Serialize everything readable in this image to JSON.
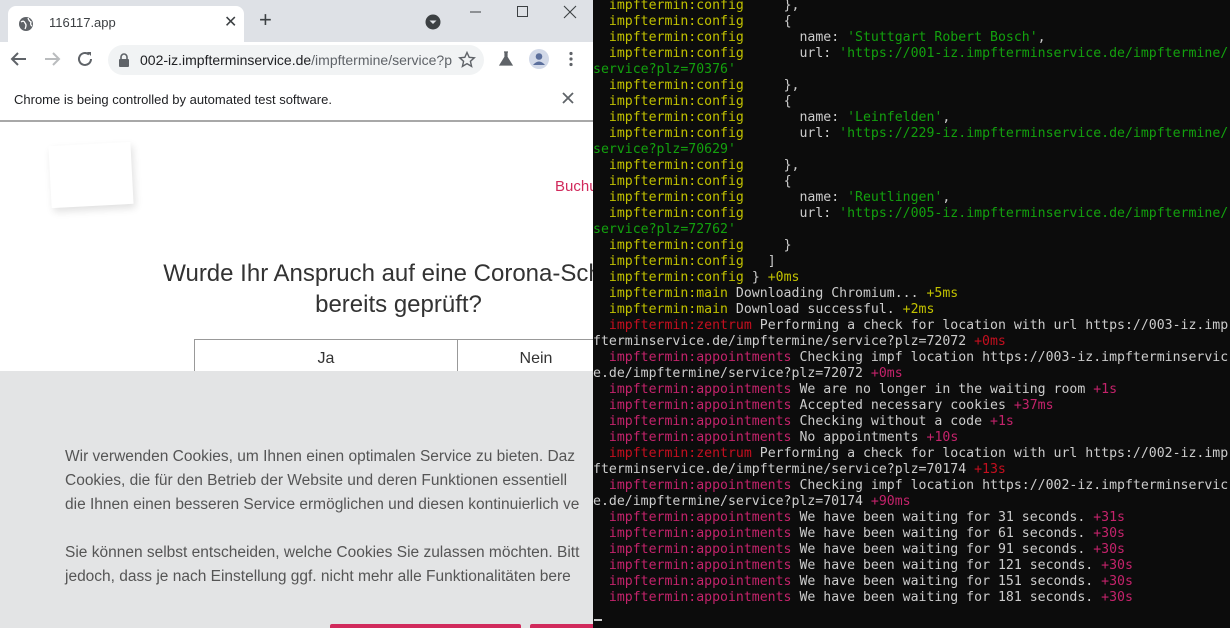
{
  "browser": {
    "tab_title": "116117.app",
    "url_host": "002-iz.impfterminservice.de",
    "url_path": "/impftermine/service?p",
    "infobar_message": "Chrome is being controlled by automated test software.",
    "icons": [
      "globe-icon",
      "close-icon",
      "plus-icon",
      "tab-search-icon",
      "minimize-icon",
      "maximize-icon",
      "window-close-icon",
      "back-arrow-icon",
      "forward-arrow-icon",
      "reload-icon",
      "lock-icon",
      "star-icon",
      "flask-icon",
      "profile-icon",
      "kebab-menu-icon"
    ]
  },
  "page": {
    "nav_link": "Buchu",
    "question_line1": "Wurde Ihr Anspruch auf eine Corona-Schutz",
    "question_line2": "bereits geprüft?",
    "choice_yes": "Ja",
    "choice_no": "Nein",
    "cookie_lines": [
      "Wir verwenden Cookies, um Ihnen einen optimalen Service zu bieten. Daz",
      "Cookies, die für den Betrieb der Website und deren Funktionen essentiell",
      "die Ihnen einen besseren Service ermöglichen und diesen kontinuierlich ve",
      "Sie können selbst entscheiden, welche Cookies Sie zulassen möchten. Bitt",
      "jedoch, dass je nach Einstellung ggf. nicht mehr alle Funktionalitäten bere"
    ],
    "accent_color": "#d12a5c"
  },
  "terminal": {
    "lines": [
      {
        "ns": "impftermin:config",
        "nsClass": "ns-config",
        "msg": "     },",
        "delta": "",
        "dClass": ""
      },
      {
        "ns": "impftermin:config",
        "nsClass": "ns-config",
        "msg": "     {",
        "delta": "",
        "dClass": ""
      },
      {
        "ns": "impftermin:config",
        "nsClass": "ns-config",
        "msg": "       name: ",
        "str": "'Stuttgart Robert Bosch'",
        "tail": ",",
        "delta": "",
        "dClass": ""
      },
      {
        "ns": "impftermin:config",
        "nsClass": "ns-config",
        "msg": "       url: ",
        "str": "'https://001-iz.impfterminservice.de/impftermine/",
        "tail": "",
        "delta": "",
        "dClass": ""
      },
      {
        "raw": "service?plz=70376'",
        "rawClass": "str"
      },
      {
        "ns": "impftermin:config",
        "nsClass": "ns-config",
        "msg": "     },",
        "delta": "",
        "dClass": ""
      },
      {
        "ns": "impftermin:config",
        "nsClass": "ns-config",
        "msg": "     {",
        "delta": "",
        "dClass": ""
      },
      {
        "ns": "impftermin:config",
        "nsClass": "ns-config",
        "msg": "       name: ",
        "str": "'Leinfelden'",
        "tail": ",",
        "delta": "",
        "dClass": ""
      },
      {
        "ns": "impftermin:config",
        "nsClass": "ns-config",
        "msg": "       url: ",
        "str": "'https://229-iz.impfterminservice.de/impftermine/",
        "tail": "",
        "delta": "",
        "dClass": ""
      },
      {
        "raw": "service?plz=70629'",
        "rawClass": "str"
      },
      {
        "ns": "impftermin:config",
        "nsClass": "ns-config",
        "msg": "     },",
        "delta": "",
        "dClass": ""
      },
      {
        "ns": "impftermin:config",
        "nsClass": "ns-config",
        "msg": "     {",
        "delta": "",
        "dClass": ""
      },
      {
        "ns": "impftermin:config",
        "nsClass": "ns-config",
        "msg": "       name: ",
        "str": "'Reutlingen'",
        "tail": ",",
        "delta": "",
        "dClass": ""
      },
      {
        "ns": "impftermin:config",
        "nsClass": "ns-config",
        "msg": "       url: ",
        "str": "'https://005-iz.impfterminservice.de/impftermine/",
        "tail": "",
        "delta": "",
        "dClass": ""
      },
      {
        "raw": "service?plz=72762'",
        "rawClass": "str"
      },
      {
        "ns": "impftermin:config",
        "nsClass": "ns-config",
        "msg": "     }",
        "delta": "",
        "dClass": ""
      },
      {
        "ns": "impftermin:config",
        "nsClass": "ns-config",
        "msg": "   ]",
        "delta": "",
        "dClass": ""
      },
      {
        "ns": "impftermin:config",
        "nsClass": "ns-config",
        "msg": " } ",
        "delta": "+0ms",
        "dClass": "d-y"
      },
      {
        "ns": "impftermin:main",
        "nsClass": "ns-main",
        "msg": " Downloading Chromium... ",
        "delta": "+5ms",
        "dClass": "d-y"
      },
      {
        "ns": "impftermin:main",
        "nsClass": "ns-main",
        "msg": " Download successful. ",
        "delta": "+2ms",
        "dClass": "d-y"
      },
      {
        "ns": "impftermin:zentrum",
        "nsClass": "ns-red",
        "msg": " Performing a check for location with url https://003-iz.imp",
        "delta": "",
        "dClass": ""
      },
      {
        "raw": "fterminservice.de/impftermine/service?plz=72072 ",
        "delta": "+0ms",
        "dClass": "d-r"
      },
      {
        "ns": "impftermin:appointments",
        "nsClass": "ns-mag",
        "msg": " Checking impf location https://003-iz.impfterminservic",
        "delta": "",
        "dClass": ""
      },
      {
        "raw": "e.de/impftermine/service?plz=72072 ",
        "delta": "+0ms",
        "dClass": "d-m"
      },
      {
        "ns": "impftermin:appointments",
        "nsClass": "ns-mag",
        "msg": " We are no longer in the waiting room ",
        "delta": "+1s",
        "dClass": "d-m"
      },
      {
        "ns": "impftermin:appointments",
        "nsClass": "ns-mag",
        "msg": " Accepted necessary cookies ",
        "delta": "+37ms",
        "dClass": "d-m"
      },
      {
        "ns": "impftermin:appointments",
        "nsClass": "ns-mag",
        "msg": " Checking without a code ",
        "delta": "+1s",
        "dClass": "d-m"
      },
      {
        "ns": "impftermin:appointments",
        "nsClass": "ns-mag",
        "msg": " No appointments ",
        "delta": "+10s",
        "dClass": "d-m"
      },
      {
        "ns": "impftermin:zentrum",
        "nsClass": "ns-red",
        "msg": " Performing a check for location with url https://002-iz.imp",
        "delta": "",
        "dClass": ""
      },
      {
        "raw": "fterminservice.de/impftermine/service?plz=70174 ",
        "delta": "+13s",
        "dClass": "d-r"
      },
      {
        "ns": "impftermin:appointments",
        "nsClass": "ns-mag",
        "msg": " Checking impf location https://002-iz.impfterminservic",
        "delta": "",
        "dClass": ""
      },
      {
        "raw": "e.de/impftermine/service?plz=70174 ",
        "delta": "+90ms",
        "dClass": "d-m"
      },
      {
        "ns": "impftermin:appointments",
        "nsClass": "ns-mag",
        "msg": " We have been waiting for 31 seconds. ",
        "delta": "+31s",
        "dClass": "d-m"
      },
      {
        "ns": "impftermin:appointments",
        "nsClass": "ns-mag",
        "msg": " We have been waiting for 61 seconds. ",
        "delta": "+30s",
        "dClass": "d-m"
      },
      {
        "ns": "impftermin:appointments",
        "nsClass": "ns-mag",
        "msg": " We have been waiting for 91 seconds. ",
        "delta": "+30s",
        "dClass": "d-m"
      },
      {
        "ns": "impftermin:appointments",
        "nsClass": "ns-mag",
        "msg": " We have been waiting for 121 seconds. ",
        "delta": "+30s",
        "dClass": "d-m"
      },
      {
        "ns": "impftermin:appointments",
        "nsClass": "ns-mag",
        "msg": " We have been waiting for 151 seconds. ",
        "delta": "+30s",
        "dClass": "d-m"
      },
      {
        "ns": "impftermin:appointments",
        "nsClass": "ns-mag",
        "msg": " We have been waiting for 181 seconds. ",
        "delta": "+30s",
        "dClass": "d-m"
      }
    ]
  }
}
